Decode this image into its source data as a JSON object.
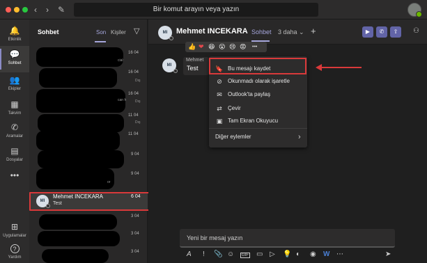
{
  "topbar": {
    "search_placeholder": "Bir komut arayın veya yazın",
    "back_icon": "‹",
    "forward_icon": "›",
    "compose_icon": "✎"
  },
  "rail": {
    "items": [
      {
        "label": "Etkinlik",
        "icon": "bell-icon",
        "glyph": "🔔"
      },
      {
        "label": "Sohbet",
        "icon": "chat-icon",
        "glyph": "💬"
      },
      {
        "label": "Ekipler",
        "icon": "teams-icon",
        "glyph": "👥"
      },
      {
        "label": "Takvim",
        "icon": "calendar-icon",
        "glyph": "▦"
      },
      {
        "label": "Aramalar",
        "icon": "phone-icon",
        "glyph": "✆"
      },
      {
        "label": "Dosyalar",
        "icon": "files-icon",
        "glyph": "▤"
      },
      {
        "label": "",
        "icon": "more-icon",
        "glyph": "•••"
      },
      {
        "label": "Uygulamalar",
        "icon": "apps-icon",
        "glyph": "⊞"
      },
      {
        "label": "Yardım",
        "icon": "help-icon",
        "glyph": "?"
      }
    ]
  },
  "chatlist": {
    "title": "Sohbet",
    "tab_recent": "Son",
    "tab_contacts": "Kişiler",
    "filter_icon": "▽",
    "snippets": {
      "s1": "cial:",
      "s2": "can h",
      "s3": "or"
    },
    "selected": {
      "initials": "MI",
      "name": "Mehmet INCEKARA",
      "preview": "Test",
      "date": "6 04"
    },
    "dates": [
      "16 04",
      "16 04",
      "16 04",
      "11 04",
      "11 04",
      "9 04",
      "9 04",
      "3 04",
      "3 04",
      "3 04"
    ],
    "small_labels": [
      "Dış",
      "Dış",
      "Dış"
    ]
  },
  "main": {
    "initials": "MI",
    "name": "Mehmet INCEKARA",
    "tab": "Sohbet",
    "more_tabs": "3 daha",
    "plus": "+",
    "message_sender": "Mehmet",
    "message_text": "Test",
    "reactions": [
      "👍",
      "❤",
      "😆",
      "😮",
      "😢",
      "😡",
      "•••"
    ],
    "context_menu": [
      {
        "label": "Bu mesajı kaydet",
        "glyph": "🔖",
        "icon": "bookmark-icon"
      },
      {
        "label": "Okunmadı olarak işaretle",
        "glyph": "⊘",
        "icon": "unread-icon"
      },
      {
        "label": "Outlook'ta paylaş",
        "glyph": "✉",
        "icon": "mail-icon"
      },
      {
        "label": "Çevir",
        "glyph": "⇄",
        "icon": "translate-icon"
      },
      {
        "label": "Tam Ekran Okuyucu",
        "glyph": "▣",
        "icon": "reader-icon"
      },
      {
        "label": "Diğer eylemler",
        "glyph": "›",
        "icon": "chevron-right-icon"
      }
    ],
    "compose_placeholder": "Yeni bir mesaj yazın",
    "call_buttons": [
      "▶",
      "✆",
      "⇧"
    ],
    "toolbar": [
      "A",
      "!",
      "📎",
      "☺",
      "GIF",
      "▭",
      "▷",
      "💡",
      "◐",
      "◉",
      "W",
      "⋯",
      "➤"
    ]
  },
  "colors": {
    "accent": "#6264a7",
    "highlight": "#d9393a",
    "bg": "#1f1f1f"
  }
}
